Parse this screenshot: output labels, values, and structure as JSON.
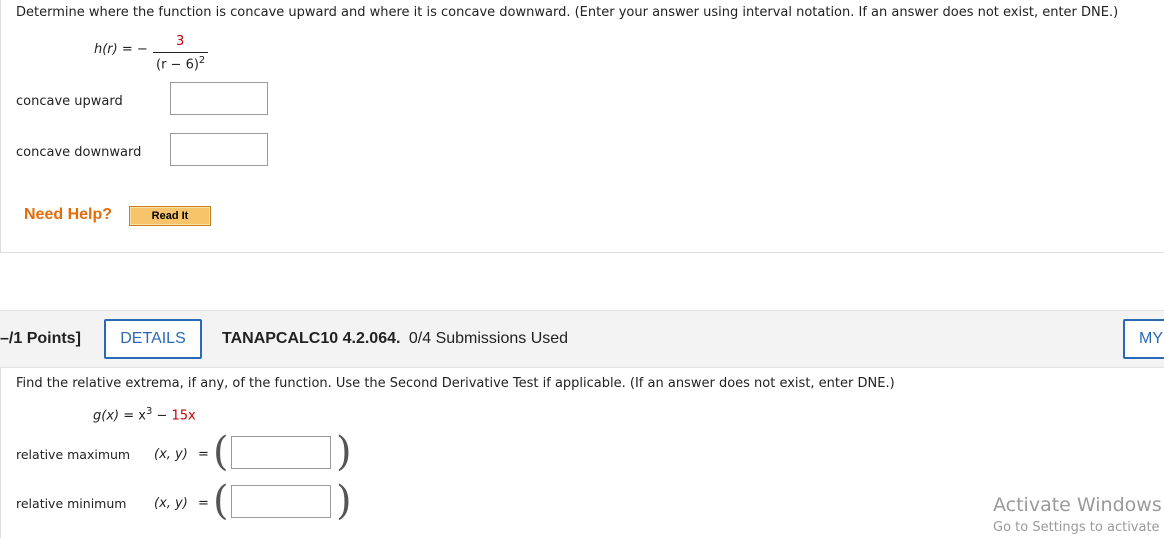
{
  "q1": {
    "prompt": "Determine where the function is concave upward and where it is concave downward. (Enter your answer using interval notation. If an answer does not exist, enter DNE.)",
    "function": {
      "lhs": "h(r)",
      "equals": "= −",
      "numerator": "3",
      "denominator_base": "(r − 6)",
      "denominator_exp": "2"
    },
    "concave_upward_label": "concave upward",
    "concave_upward_value": "",
    "concave_downward_label": "concave downward",
    "concave_downward_value": "",
    "need_help": "Need Help?",
    "read_it": "Read It"
  },
  "q2": {
    "points": "–/1 Points]",
    "details": "DETAILS",
    "code": "TANAPCALC10 4.2.064.",
    "submissions": "0/4 Submissions Used",
    "my_notes": "MY",
    "prompt": "Find the relative extrema, if any, of the function. Use the Second Derivative Test if applicable. (If an answer does not exist, enter DNE.)",
    "function": {
      "lhs": "g(x)",
      "equals": "= x",
      "exp": "3",
      "tail": "−",
      "coef": "15x"
    },
    "rel_max_label": "relative maximum",
    "rel_max_value": "",
    "rel_min_label": "relative minimum",
    "rel_min_value": "",
    "xy_label": "(x, y)",
    "equals": "="
  },
  "watermark": {
    "title": "Activate Windows",
    "subtitle": "Go to Settings to activate"
  },
  "colors": {
    "accent": "#2a69b8",
    "help": "#e36c09",
    "red_number": "#cc0000"
  }
}
